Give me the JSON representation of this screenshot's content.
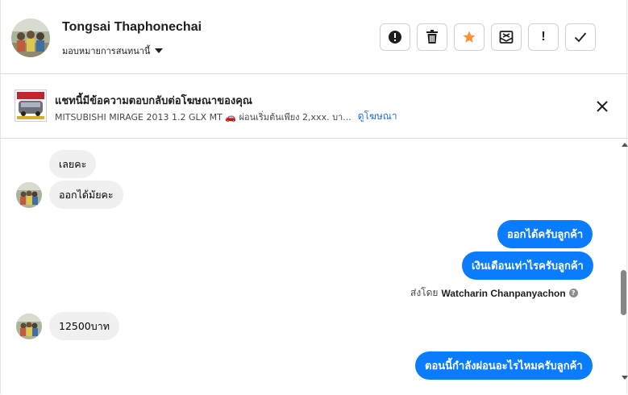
{
  "header": {
    "contact_name": "Tongsai Thaphonechai",
    "assign_label": "มอบหมายการสนทนานี้",
    "toolbar": [
      {
        "icon": "alert-circle-icon"
      },
      {
        "icon": "trash-icon"
      },
      {
        "icon": "star-icon",
        "color": "#f7923b"
      },
      {
        "icon": "mark-unread-icon"
      },
      {
        "icon": "exclamation-icon",
        "label": "!"
      },
      {
        "icon": "checkmark-icon"
      }
    ]
  },
  "ad": {
    "title": "แชทนี้มีข้อความตอบกลับต่อโฆษณาของคุณ",
    "subtitle": " MITSUBISHI MIRAGE 2013 1.2 GLX MT 🚗 ผ่อนเริ่มต้นเพียง 2,xxx. บา...",
    "link": "ดูโฆษณา"
  },
  "messages": {
    "m1": "เลยคะ",
    "m2": "ออกได้มัยคะ",
    "m3": "ออกได้ครับลูกค้า",
    "m4": "เงินเดือนเท่าไรครับลูกค้า",
    "sent_by_prefix": "ส่งโดย",
    "sent_by_name": "Watcharin Chanpanyachon",
    "m5": "12500บาท",
    "m6": "ตอนนี้กำลังผ่อนอะไรไหมครับลูกค้า"
  },
  "colors": {
    "outgoing_bubble": "#0a7cff",
    "incoming_bubble": "#f0f0f0",
    "link": "#216fdb"
  }
}
